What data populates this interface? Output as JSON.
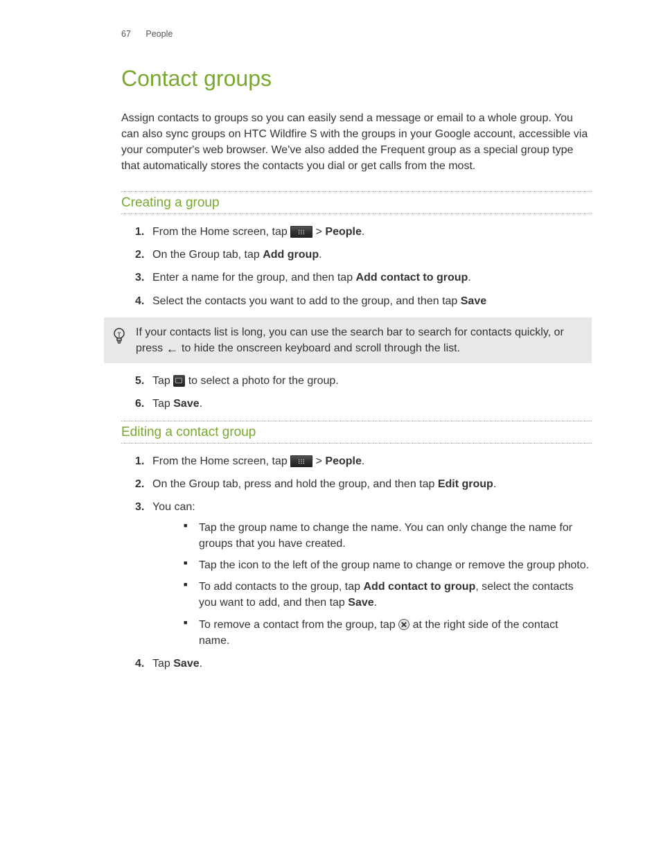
{
  "header": {
    "page_number": "67",
    "section": "People"
  },
  "title": "Contact groups",
  "intro": "Assign contacts to groups so you can easily send a message or email to a whole group. You can also sync groups on HTC Wildfire S with the groups in your Google account, accessible via your computer's web browser. We've also added the Frequent group as a special group type that automatically stores the contacts you dial or get calls from the most.",
  "section1": {
    "title": "Creating a group",
    "step1_a": "From the Home screen, tap ",
    "step1_b": " > ",
    "step1_c": "People",
    "step1_d": ".",
    "step2_a": "On the Group tab, tap ",
    "step2_b": "Add group",
    "step2_c": ".",
    "step3_a": "Enter a name for the group, and then tap ",
    "step3_b": "Add contact to group",
    "step3_c": ".",
    "step4_a": "Select the contacts you want to add to the group, and then tap ",
    "step4_b": "Save",
    "tip_a": "If your contacts list is long, you can use the search bar to search for contacts quickly, or press ",
    "tip_b": " to hide the onscreen keyboard and scroll through the list.",
    "step5_a": "Tap ",
    "step5_b": " to select a photo for the group.",
    "step6_a": "Tap ",
    "step6_b": "Save",
    "step6_c": "."
  },
  "section2": {
    "title": "Editing a contact group",
    "step1_a": "From the Home screen, tap ",
    "step1_b": " > ",
    "step1_c": "People",
    "step1_d": ".",
    "step2_a": "On the Group tab, press and hold the group, and then tap ",
    "step2_b": "Edit group",
    "step2_c": ".",
    "step3": "You can:",
    "bullet1": "Tap the group name to change the name. You can only change the name for groups that you have created.",
    "bullet2": "Tap the icon to the left of the group name to change or remove the group photo.",
    "bullet3_a": "To add contacts to the group, tap ",
    "bullet3_b": "Add contact to group",
    "bullet3_c": ", select the contacts you want to add, and then tap ",
    "bullet3_d": "Save",
    "bullet3_e": ".",
    "bullet4_a": "To remove a contact from the group, tap ",
    "bullet4_b": " at the right side of the contact name.",
    "step4_a": "Tap ",
    "step4_b": "Save",
    "step4_c": "."
  }
}
